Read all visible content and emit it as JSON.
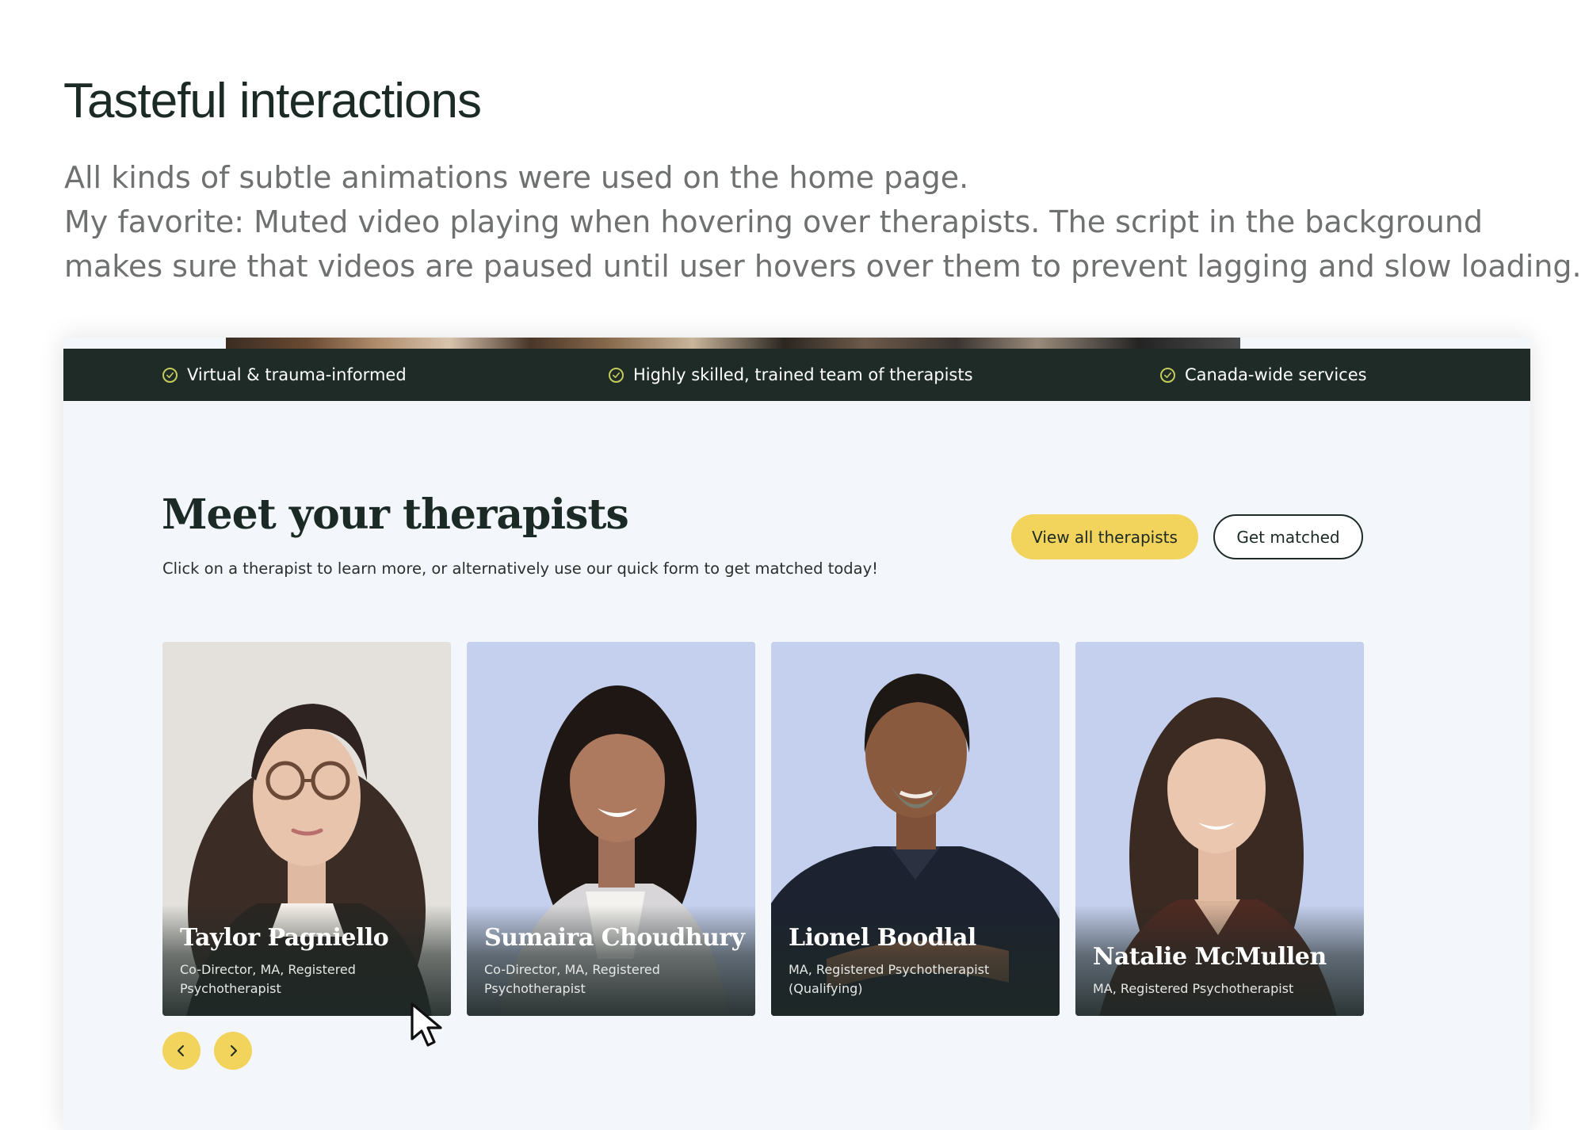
{
  "heading": "Tasteful interactions",
  "description": [
    "All kinds of subtle animations were used on the home page.",
    "My favorite: Muted video playing when hovering over therapists. The script in the background",
    "makes sure that videos are paused until user hovers over them to prevent lagging and slow loading."
  ],
  "site": {
    "trust_bar": [
      {
        "label": "Virtual & trauma-informed",
        "icon": "check-circle-icon"
      },
      {
        "label": "Highly skilled, trained team of therapists",
        "icon": "check-circle-icon"
      },
      {
        "label": "Canada-wide services",
        "icon": "check-circle-icon"
      }
    ],
    "section_title": "Meet your therapists",
    "section_subtitle": "Click on a therapist to learn more, or alternatively use our quick form to get matched today!",
    "buttons": {
      "view_all": "View all therapists",
      "get_matched": "Get matched"
    },
    "therapists": [
      {
        "name": "Taylor Pagniello",
        "role": "Co-Director, MA, Registered Psychotherapist"
      },
      {
        "name": "Sumaira Choudhury",
        "role": "Co-Director, MA, Registered Psychotherapist"
      },
      {
        "name": "Lionel Boodlal",
        "role": "MA, Registered Psychotherapist (Qualifying)"
      },
      {
        "name": "Natalie McMullen",
        "role": "MA, Registered Psychotherapist"
      }
    ],
    "carousel": {
      "prev_icon": "chevron-left-icon",
      "next_icon": "chevron-right-icon"
    }
  },
  "colors": {
    "dark_green": "#1e2b27",
    "accent_yellow": "#f2d35c",
    "card_bg_blue": "#c5d0ee",
    "section_bg": "#f3f6fb"
  }
}
